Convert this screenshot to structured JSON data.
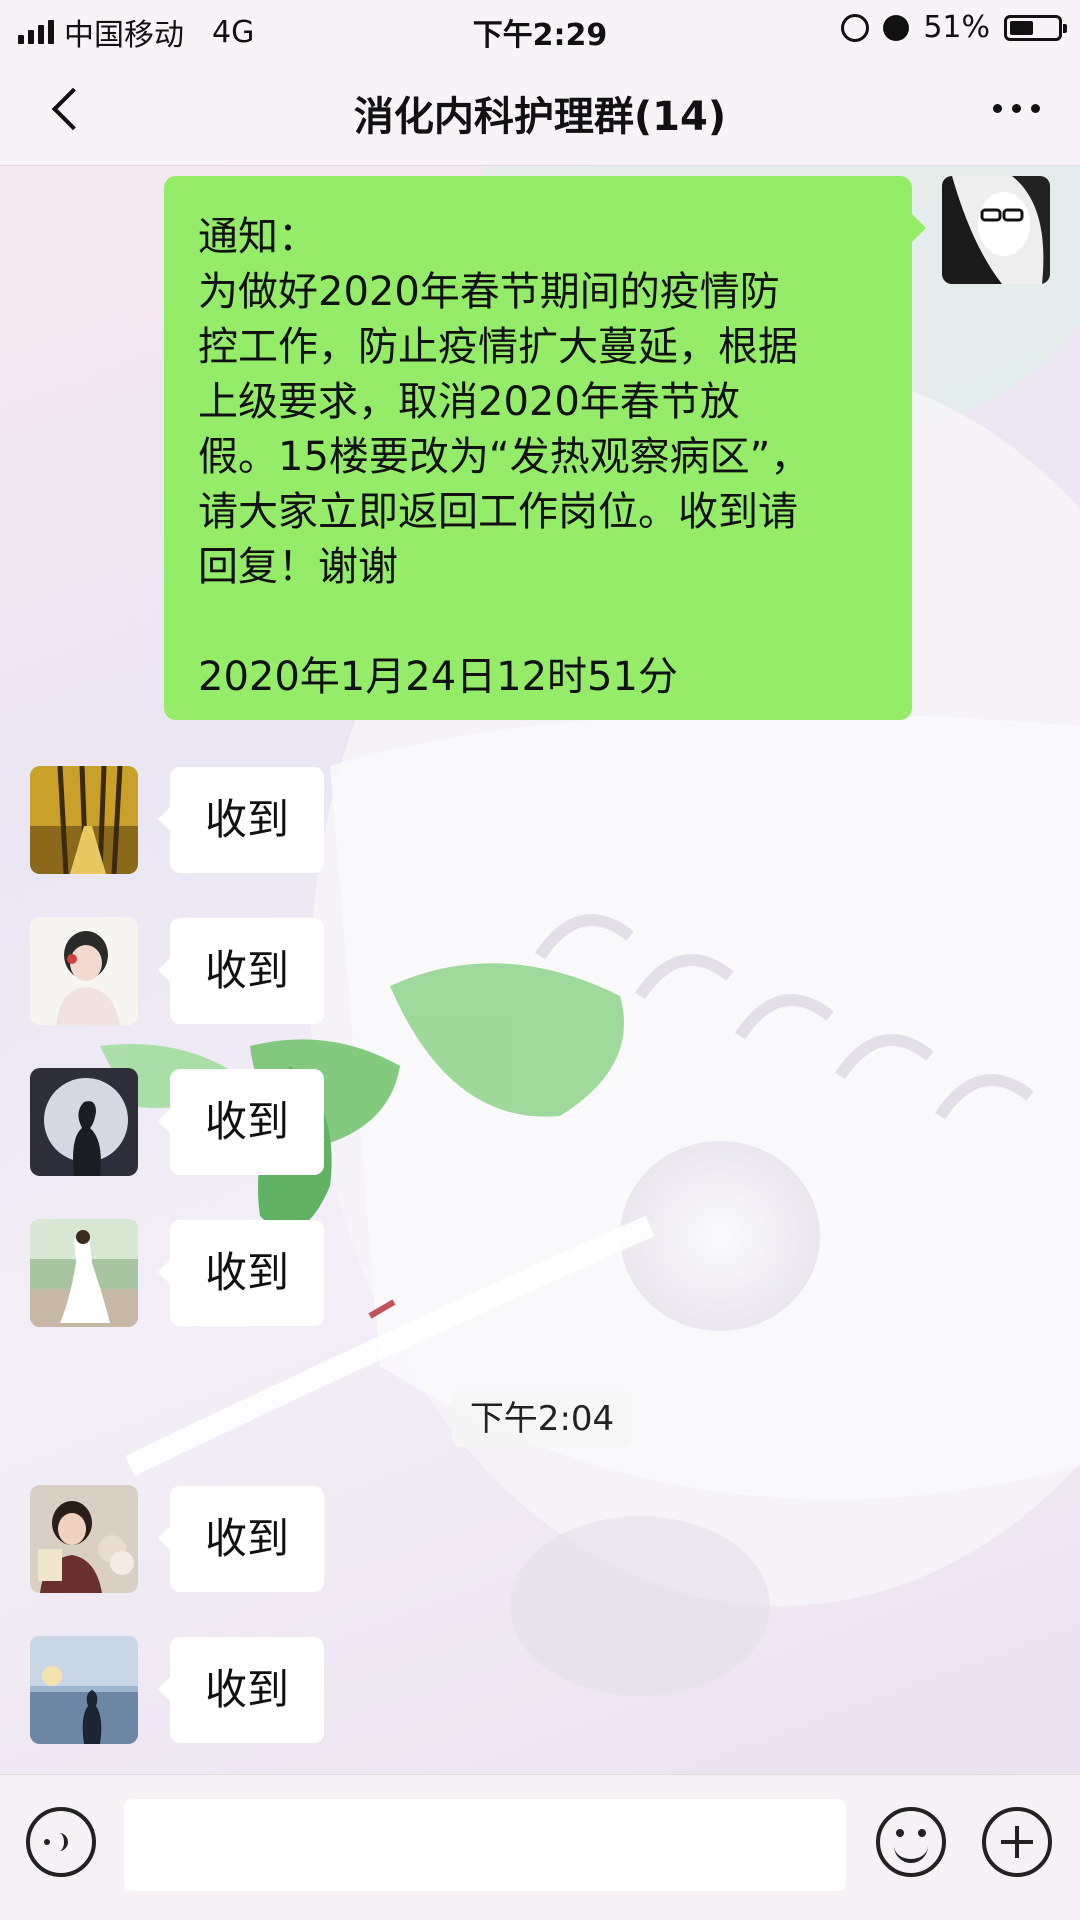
{
  "status_bar": {
    "carrier": "中国移动",
    "network": "4G",
    "time": "下午2:29",
    "battery": "51%",
    "battery_level": 0.51,
    "icons": [
      "signal-icon",
      "rotation-lock-icon",
      "alarm-icon",
      "battery-icon"
    ]
  },
  "nav": {
    "title": "消化内科护理群(14)",
    "icons": [
      "back-icon",
      "more-icon"
    ]
  },
  "messages": {
    "notice": {
      "lines": [
        "通知：",
        "为做好2020年春节期间的疫情防",
        "控工作，防止疫情扩大蔓延，根据",
        "上级要求，取消2020年春节放",
        "假。15楼要改为“发热观察病区”，",
        "请大家立即返回工作岗位。收到请",
        "回复！谢谢"
      ],
      "date": "2020年1月24日12时51分",
      "bubble_color": "#95ec69"
    },
    "replies": [
      {
        "text": "收到"
      },
      {
        "text": "收到"
      },
      {
        "text": "收到"
      },
      {
        "text": "收到"
      },
      {
        "text": "收到"
      },
      {
        "text": "收到"
      }
    ],
    "timestamp": "下午2:04"
  },
  "input_bar": {
    "placeholder": "",
    "icons": [
      "voice-icon",
      "emoji-icon",
      "plus-icon"
    ]
  }
}
